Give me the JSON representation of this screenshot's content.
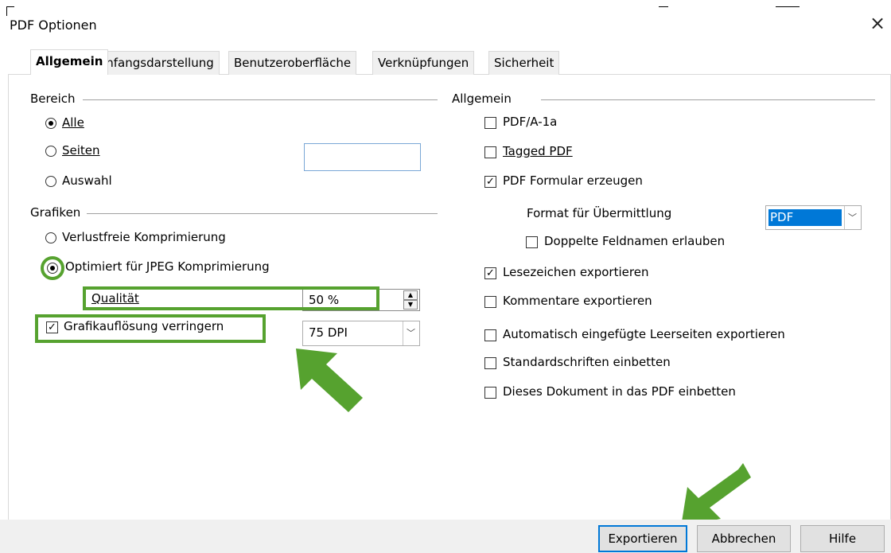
{
  "window": {
    "title": "PDF Optionen",
    "close_icon": "×"
  },
  "tabs": [
    {
      "label": "Allgemein",
      "active": true
    },
    {
      "label": "Anfangsdarstellung",
      "active": false
    },
    {
      "label": "Benutzeroberfläche",
      "active": false
    },
    {
      "label": "Verknüpfungen",
      "active": false
    },
    {
      "label": "Sicherheit",
      "active": false
    }
  ],
  "left": {
    "bereich": {
      "heading": "Bereich",
      "alle": {
        "label": "Alle",
        "selected": true
      },
      "seiten": {
        "label": "Seiten",
        "value": ""
      },
      "auswahl": {
        "label": "Auswahl"
      }
    },
    "grafiken": {
      "heading": "Grafiken",
      "verlustfrei": {
        "label": "Verlustfreie Komprimierung"
      },
      "jpeg": {
        "label": "Optimiert für JPEG Komprimierung",
        "selected": true
      },
      "qualitaet": {
        "label": "Qualität",
        "value": "50 %"
      },
      "aufloesung": {
        "label": "Grafikauflösung verringern",
        "checked": true,
        "value": "75 DPI"
      }
    }
  },
  "right": {
    "heading": "Allgemein",
    "pdfa": {
      "label": "PDF/A-1a",
      "checked": false
    },
    "tagged": {
      "label": "Tagged PDF",
      "checked": false
    },
    "formular": {
      "label": "PDF Formular erzeugen",
      "checked": true
    },
    "format": {
      "label": "Format für Übermittlung",
      "value": "PDF"
    },
    "doppelte": {
      "label": "Doppelte Feldnamen erlauben",
      "checked": false
    },
    "lesezeichen": {
      "label": "Lesezeichen exportieren",
      "checked": true
    },
    "kommentare": {
      "label": "Kommentare exportieren",
      "checked": false
    },
    "leerseiten": {
      "label": "Automatisch eingefügte Leerseiten exportieren",
      "checked": false
    },
    "standardschriften": {
      "label": "Standardschriften einbetten",
      "checked": false
    },
    "dokument": {
      "label": "Dieses Dokument in das PDF einbetten",
      "checked": false
    }
  },
  "buttons": {
    "export": "Exportieren",
    "cancel": "Abbrechen",
    "help": "Hilfe"
  },
  "colors": {
    "highlight": "#56a22f",
    "accent": "#0078d7"
  }
}
